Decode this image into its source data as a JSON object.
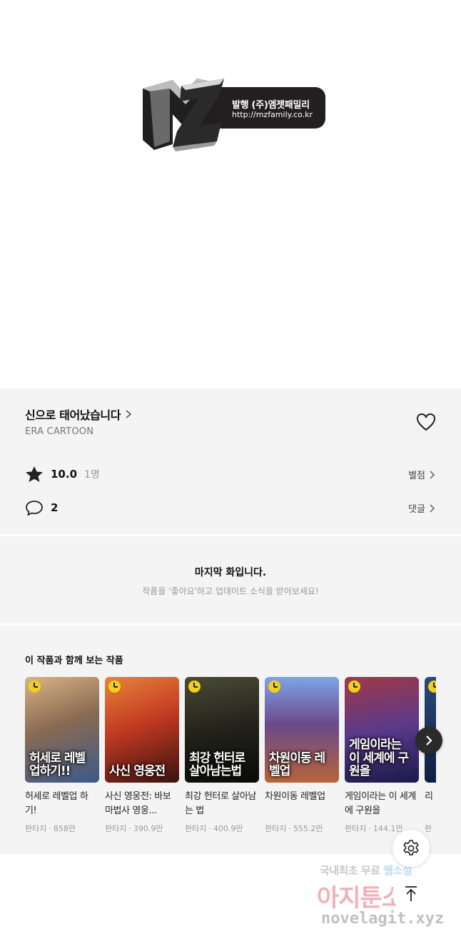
{
  "publisher_logo": {
    "mark": "MZ",
    "line1": "발행 (주)엠젯패밀리",
    "line2": "http://mzfamily.co.kr"
  },
  "work": {
    "title": "신으로 태어났습니다",
    "author": "ERA CARTOON",
    "rating_value": "10.0",
    "rating_count": "1명",
    "rating_link": "별점",
    "comment_count": "2",
    "comment_link": "댓글"
  },
  "last_episode": {
    "title": "마지막 화입니다.",
    "subtitle": "작품을 '좋아요'하고 업데이트 소식을 받아보세요!"
  },
  "recommendations": {
    "heading": "이 작품과 함께 보는 작품",
    "items": [
      {
        "title": "허세로 레벨업 하기!",
        "cover_text": "허세로 레벨업하기!!",
        "genre": "판타지",
        "views": "858만",
        "colors": [
          "#c9a27a",
          "#3b5a8a"
        ]
      },
      {
        "title": "사신 영웅전: 바보 마법사 영웅...",
        "cover_text": "사신 영웅전",
        "genre": "판타지",
        "views": "390.9만",
        "colors": [
          "#d9532b",
          "#5a1a16"
        ]
      },
      {
        "title": "최강 헌터로 살아남는 법",
        "cover_text": "최강 헌터로 살아남는법",
        "genre": "판타지",
        "views": "400.9만",
        "colors": [
          "#3a3a2a",
          "#0f0f0f"
        ]
      },
      {
        "title": "차원이동 레벨업",
        "cover_text": "차원이동 레벨업",
        "genre": "판타지",
        "views": "555.2만",
        "colors": [
          "#6b8fd6",
          "#c85a3a"
        ]
      },
      {
        "title": "게임이라는 이 세계에 구원을",
        "cover_text": "게임이라는 이 세계에 구원을",
        "genre": "판타지",
        "views": "144.1만",
        "colors": [
          "#8a2a3a",
          "#2a2a6a"
        ]
      },
      {
        "title": "리",
        "cover_text": "",
        "genre": "판",
        "views": "",
        "colors": [
          "#1a3a6a",
          "#0a1a3a"
        ]
      }
    ]
  },
  "watermark": {
    "line1_a": "국내최초 무료 ",
    "line1_b": "웹소설",
    "line2": "아지툰소설",
    "line3": "novelagit.xyz"
  },
  "icons": {
    "heart": "heart-icon",
    "star": "star-icon",
    "comment": "comment-icon",
    "chevron": "chevron-right-icon",
    "settings": "gear-icon",
    "scroll_top": "arrow-up-icon"
  }
}
